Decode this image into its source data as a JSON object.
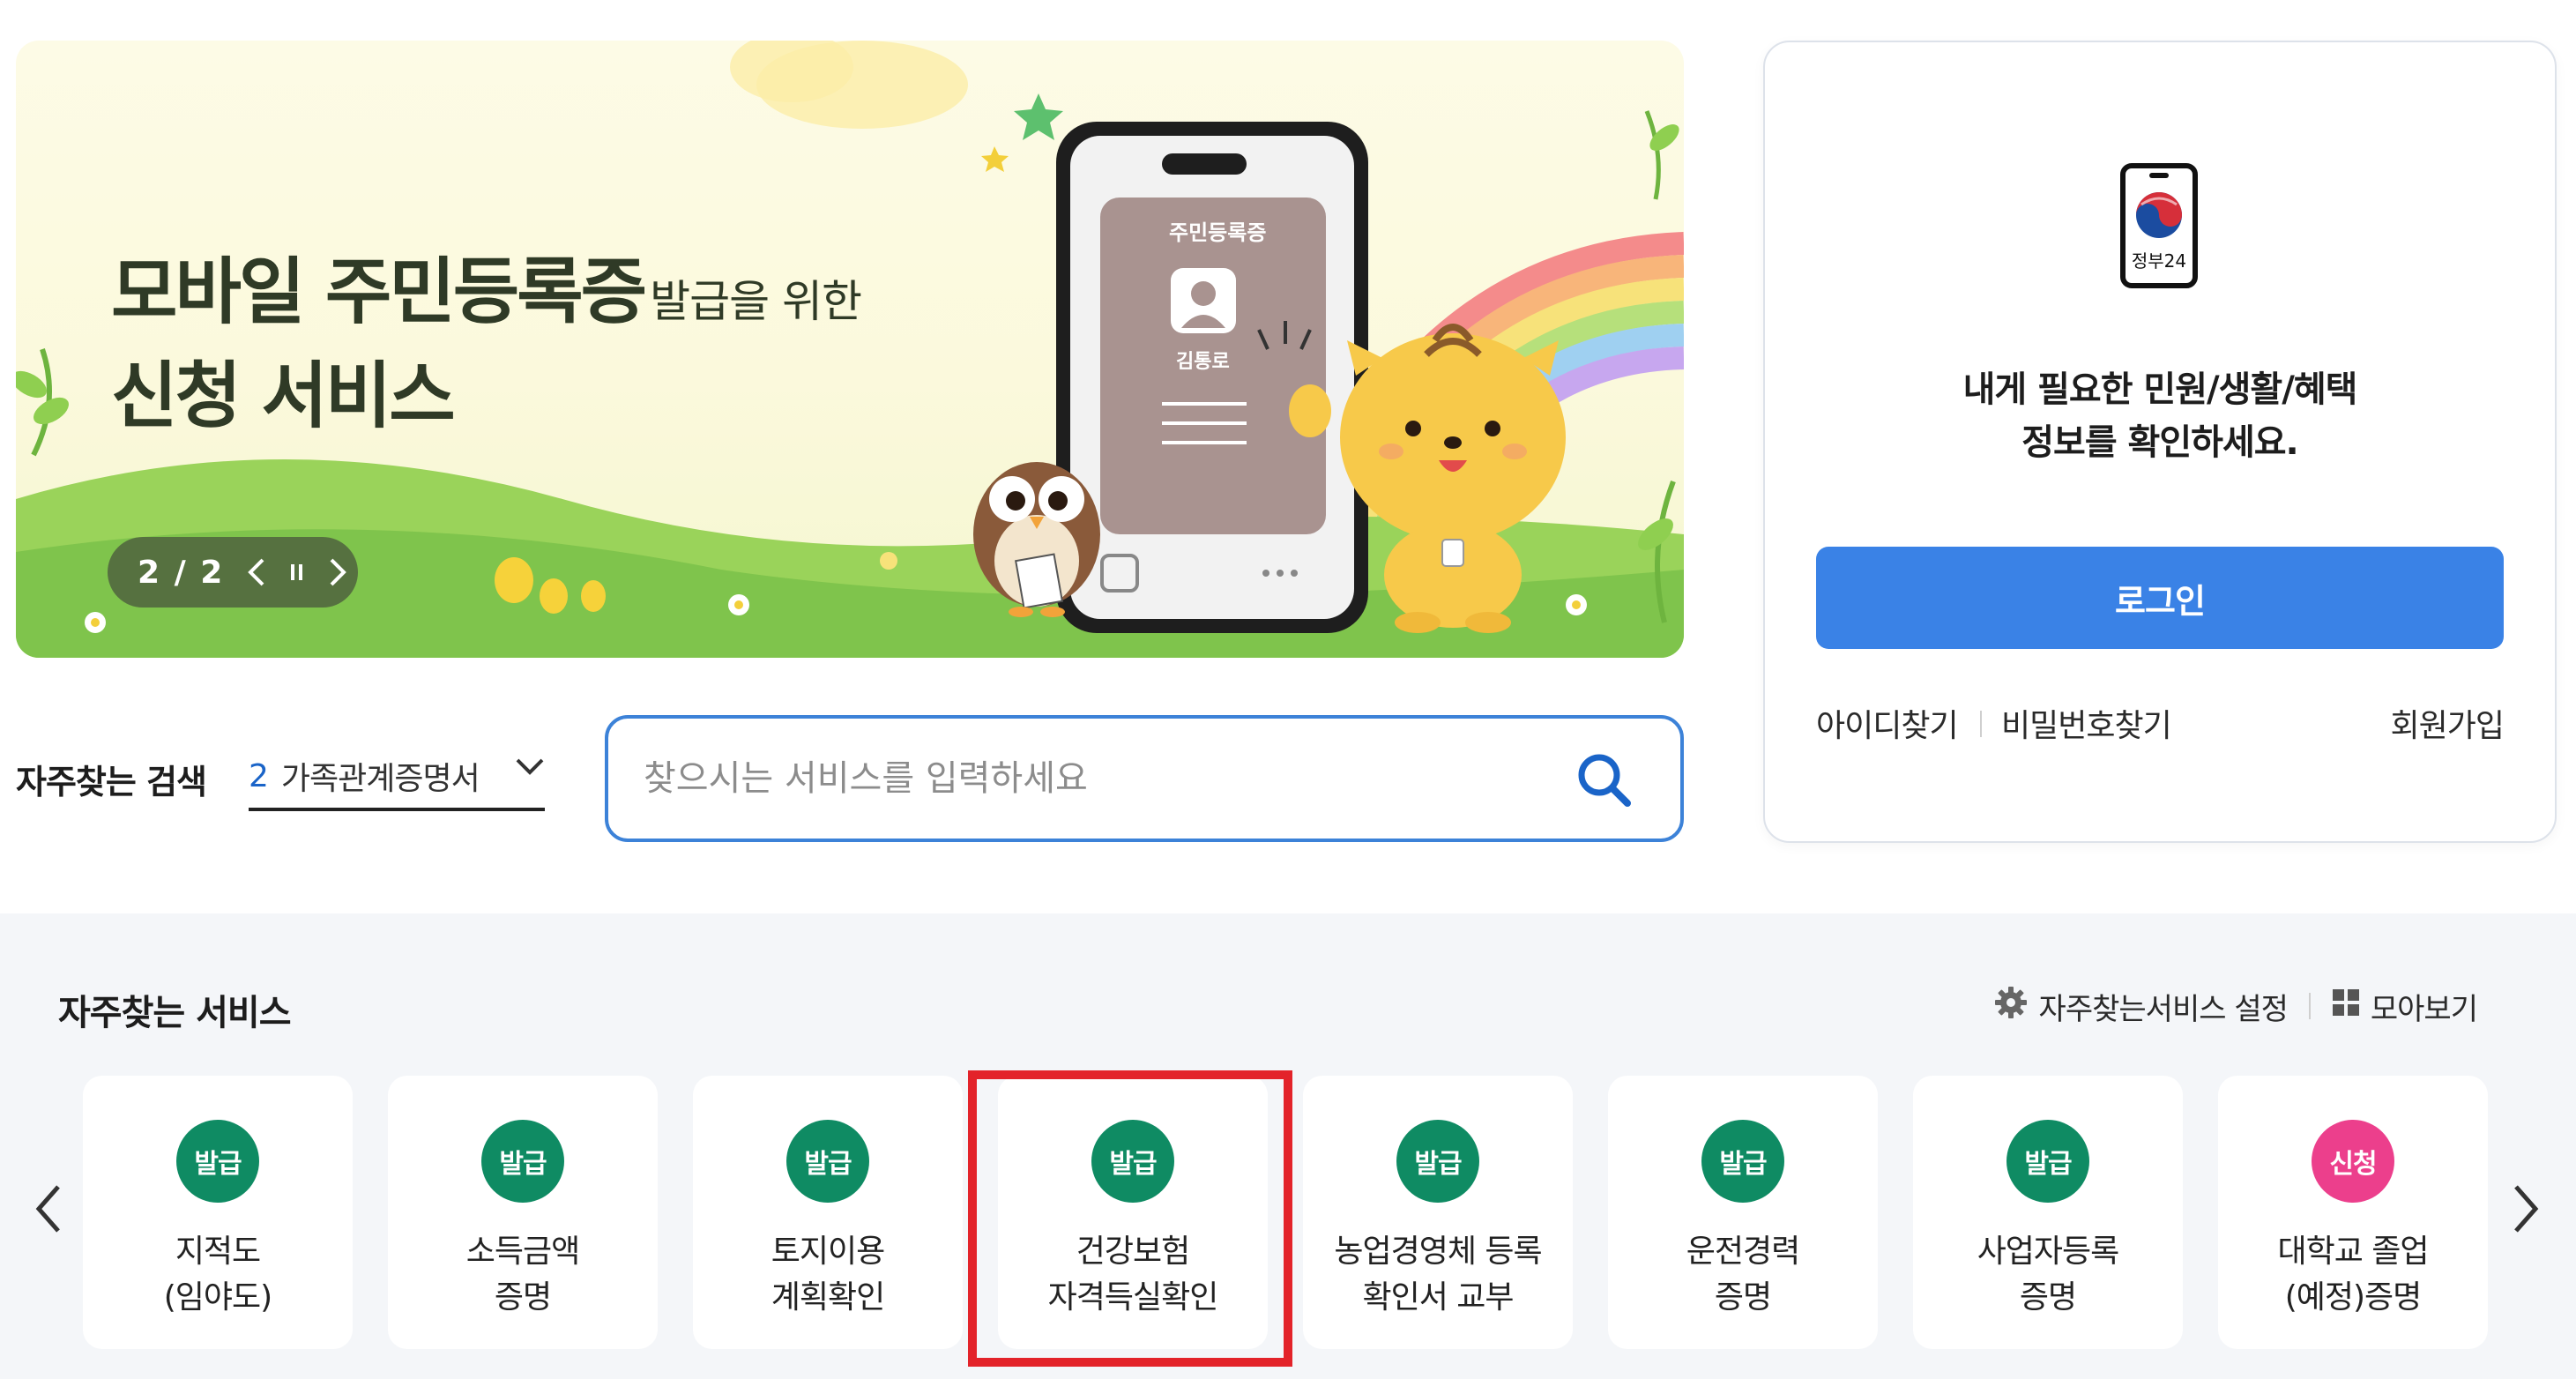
{
  "banner": {
    "title_main": "모바일 주민등록증",
    "title_small": "발급을 위한",
    "title_line2": "신청 서비스",
    "phone_card_title": "주민등록증",
    "phone_card_name": "김통로",
    "slider": {
      "counter": "2 / 2",
      "prev_icon": "chevron-left-icon",
      "pause_icon": "pause-icon",
      "next_icon": "chevron-right-icon"
    }
  },
  "frequent_search": {
    "label": "자주찾는 검색",
    "selected_number": "2",
    "selected_text": "가족관계증명서"
  },
  "search": {
    "placeholder": "찾으시는 서비스를 입력하세요",
    "value": ""
  },
  "login": {
    "logo_text": "정부24",
    "message_line1": "내게 필요한 민원/생활/혜택",
    "message_line2": "정보를 확인하세요.",
    "login_button": "로그인",
    "find_id": "아이디찾기",
    "find_password": "비밀번호찾기",
    "signup": "회원가입"
  },
  "frequent_services": {
    "title": "자주찾는 서비스",
    "settings_label": "자주찾는서비스 설정",
    "view_all_label": "모아보기",
    "items": [
      {
        "badge": "발급",
        "badge_color": "#0f8b63",
        "name": "지적도\n(임야도)"
      },
      {
        "badge": "발급",
        "badge_color": "#0f8b63",
        "name": "소득금액\n증명"
      },
      {
        "badge": "발급",
        "badge_color": "#0f8b63",
        "name": "토지이용\n계획확인"
      },
      {
        "badge": "발급",
        "badge_color": "#0f8b63",
        "name": "건강보험\n자격득실확인"
      },
      {
        "badge": "발급",
        "badge_color": "#0f8b63",
        "name": "농업경영체 등록\n확인서 교부"
      },
      {
        "badge": "발급",
        "badge_color": "#0f8b63",
        "name": "운전경력\n증명"
      },
      {
        "badge": "발급",
        "badge_color": "#0f8b63",
        "name": "사업자등록\n증명"
      },
      {
        "badge": "신청",
        "badge_color": "#ec3f8c",
        "name": "대학교 졸업\n(예정)증명"
      }
    ]
  },
  "colors": {
    "primary_blue": "#3a82e6",
    "search_border": "#3c82d8",
    "highlight_red": "#e3232a",
    "section_bg": "#f4f6f9"
  }
}
